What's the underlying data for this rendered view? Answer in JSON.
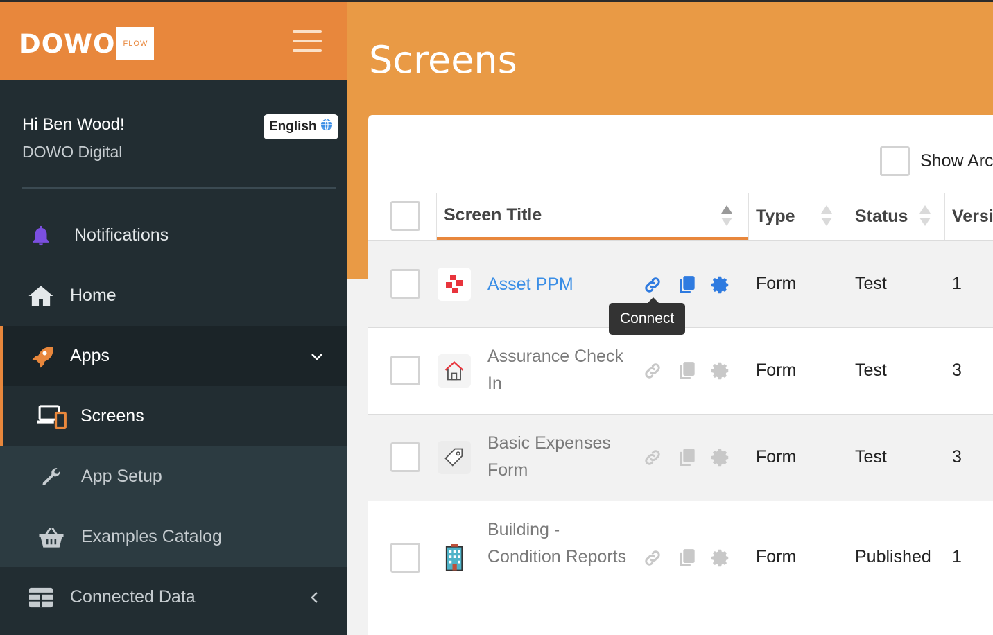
{
  "brand": {
    "name": "DOWO",
    "badge": "FLOW"
  },
  "user": {
    "greeting": "Hi Ben Wood!",
    "org": "DOWO Digital",
    "language": "English"
  },
  "nav": {
    "notifications": "Notifications",
    "home": "Home",
    "apps": "Apps",
    "screens": "Screens",
    "app_setup": "App Setup",
    "examples_catalog": "Examples Catalog",
    "connected_data": "Connected Data"
  },
  "page": {
    "title": "Screens"
  },
  "toolbar": {
    "show_archived": "Show Arc"
  },
  "table": {
    "headers": {
      "title": "Screen Title",
      "type": "Type",
      "status": "Status",
      "version": "Versi"
    },
    "rows": [
      {
        "title": "Asset PPM",
        "type": "Form",
        "status": "Test",
        "version": "1",
        "icon": "asset-ppm-icon"
      },
      {
        "title": "Assurance Check In",
        "type": "Form",
        "status": "Test",
        "version": "3",
        "icon": "house-icon"
      },
      {
        "title": "Basic Expenses Form",
        "type": "Form",
        "status": "Test",
        "version": "3",
        "icon": "tag-icon"
      },
      {
        "title": "Building - Condition Reports",
        "type": "Form",
        "status": "Published",
        "version": "1",
        "icon": "building-icon"
      }
    ]
  },
  "tooltip": {
    "text": "Connect"
  },
  "colors": {
    "accent": "#e8873c",
    "header": "#e99a45",
    "sidebar": "#222d32",
    "link": "#3a8ee6",
    "icon_active": "#2f7be0",
    "icon_muted": "#c8c8c8"
  }
}
